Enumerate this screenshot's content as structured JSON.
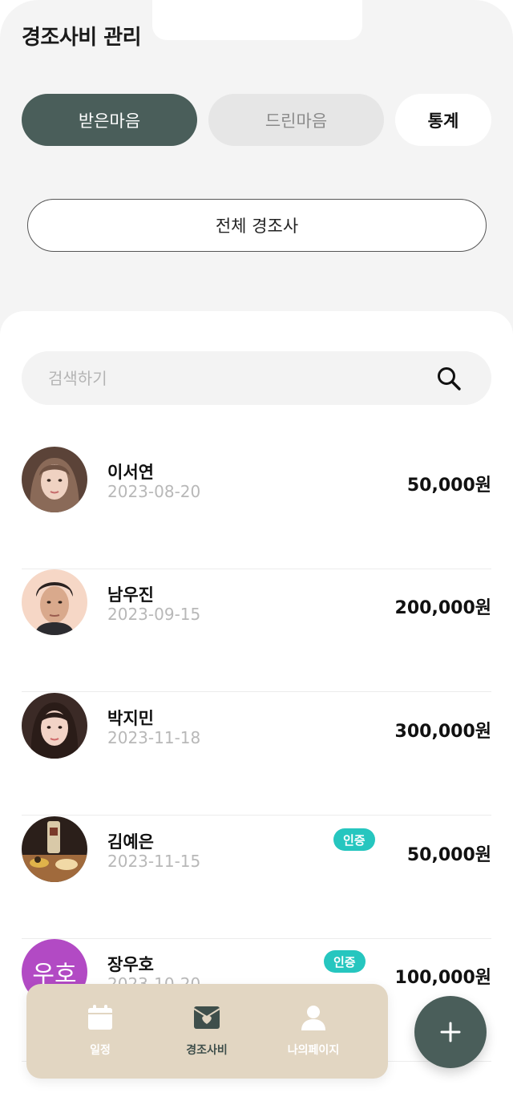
{
  "header": {
    "title": "경조사비 관리"
  },
  "segments": {
    "received": "받은마음",
    "given": "드린마음",
    "stats": "통계"
  },
  "filter": {
    "selected": "전체 경조사"
  },
  "search": {
    "placeholder": "검색하기",
    "value": ""
  },
  "colors": {
    "accent": "#4a5e5a",
    "badge": "#26c6bf",
    "nav_background": "#e2d6c2",
    "initials_avatar": "#b24ac4"
  },
  "entries": [
    {
      "name": "이서연",
      "date": "2023-08-20",
      "amount": "50,000원",
      "badge": ""
    },
    {
      "name": "남우진",
      "date": "2023-09-15",
      "amount": "200,000원",
      "badge": ""
    },
    {
      "name": "박지민",
      "date": "2023-11-18",
      "amount": "300,000원",
      "badge": ""
    },
    {
      "name": "김예은",
      "date": "2023-11-15",
      "amount": "50,000원",
      "badge": "인증"
    },
    {
      "name": "장우호",
      "date": "2023-10-20",
      "amount": "100,000원",
      "badge": "인증",
      "initials": "우호"
    }
  ],
  "nav": [
    {
      "label": "일정",
      "icon": "calendar-icon"
    },
    {
      "label": "경조사비",
      "icon": "heart-mail-icon",
      "active": true
    },
    {
      "label": "나의페이지",
      "icon": "person-icon"
    }
  ],
  "fab": {
    "icon": "plus-icon"
  }
}
